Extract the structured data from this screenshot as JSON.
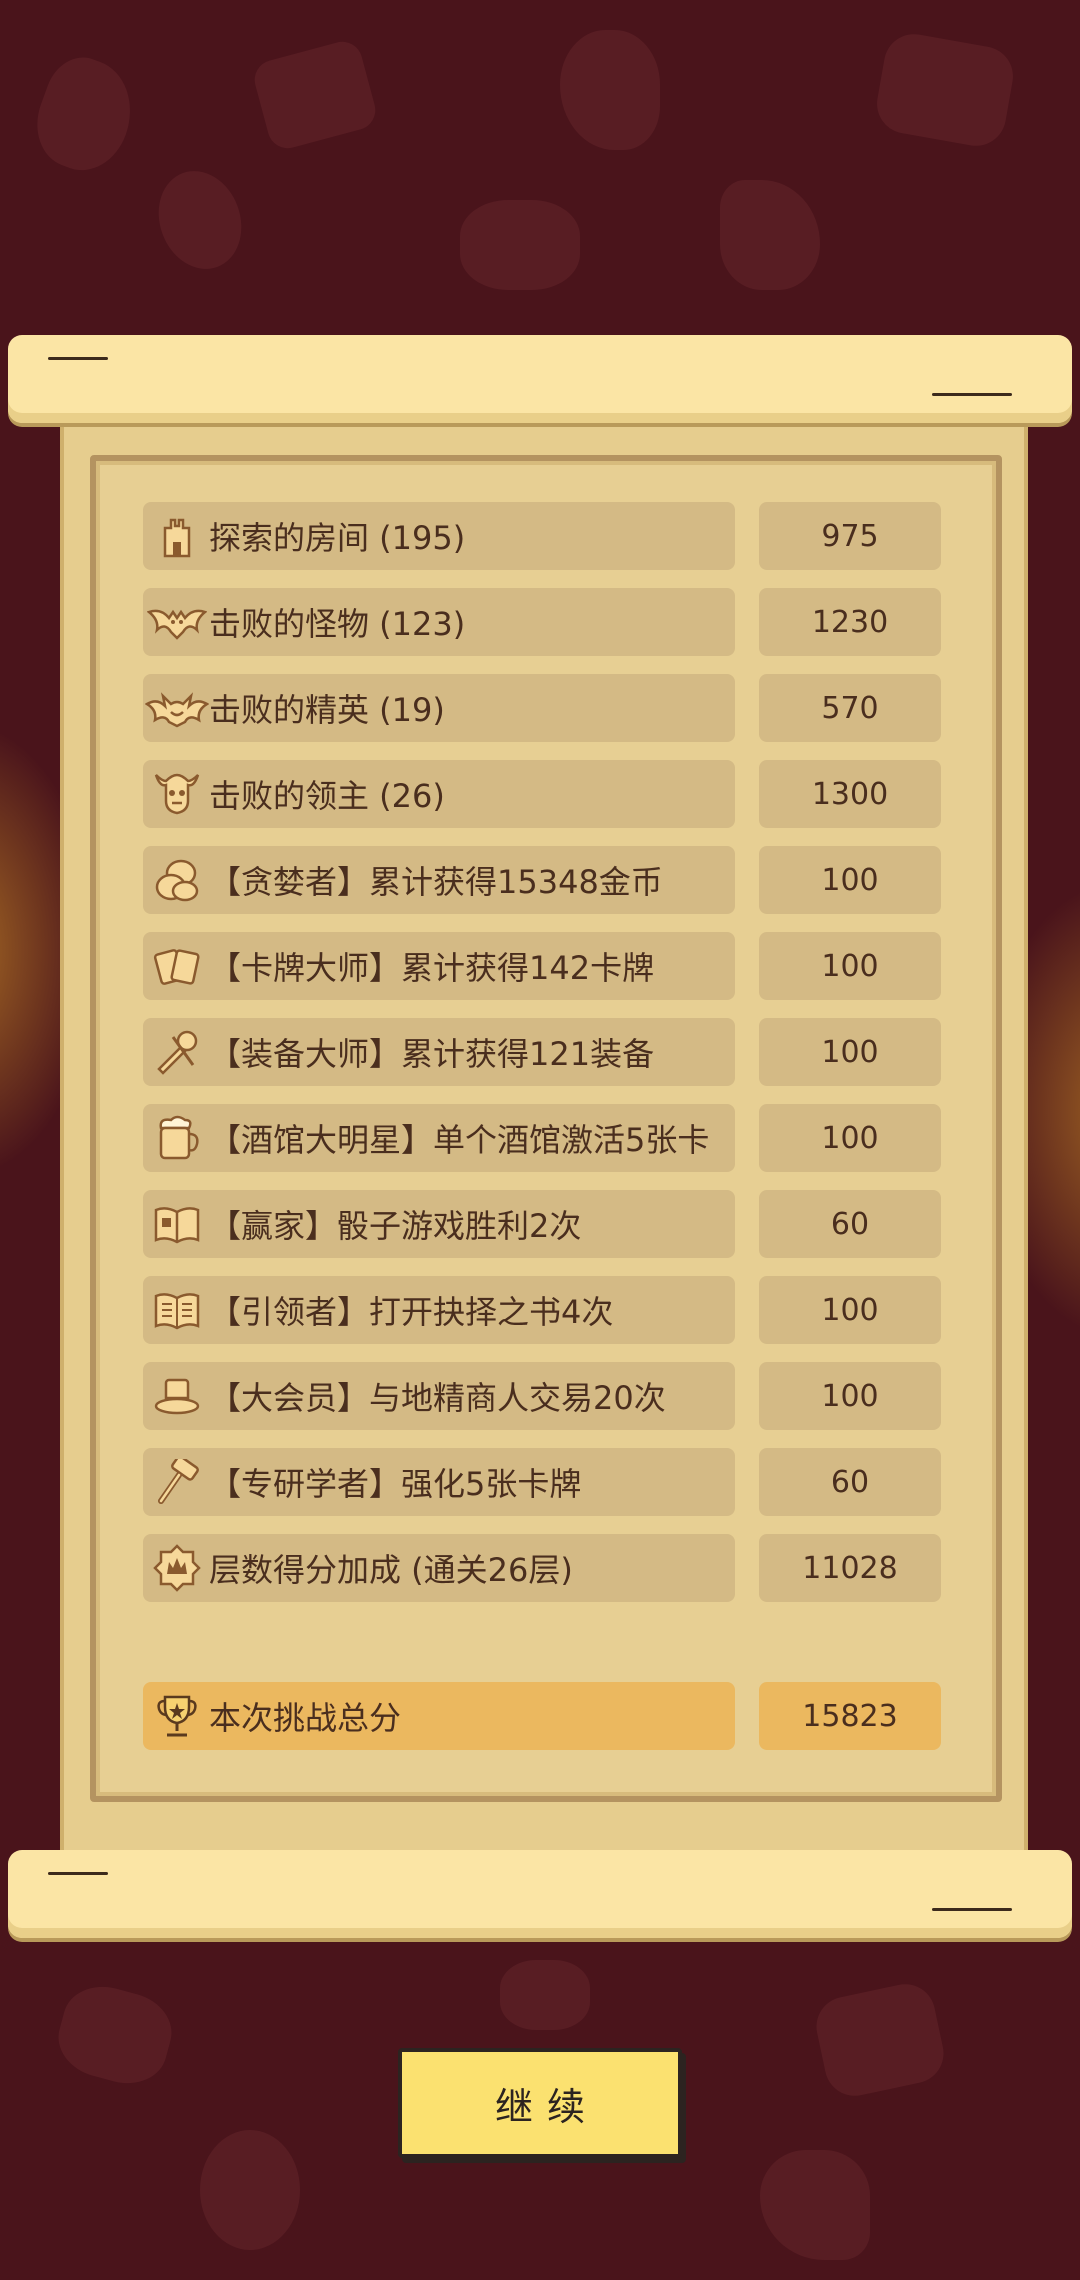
{
  "rows": [
    {
      "label": "探索的房间 (195)",
      "value": "975",
      "icon": "tower-icon"
    },
    {
      "label": "击败的怪物 (123)",
      "value": "1230",
      "icon": "bat-icon"
    },
    {
      "label": "击败的精英 (19)",
      "value": "570",
      "icon": "elite-demon-icon"
    },
    {
      "label": "击败的领主 (26)",
      "value": "1300",
      "icon": "boss-skull-icon"
    },
    {
      "label": "【贪婪者】累计获得15348金币",
      "value": "100",
      "icon": "coins-icon"
    },
    {
      "label": "【卡牌大师】累计获得142卡牌",
      "value": "100",
      "icon": "cards-icon"
    },
    {
      "label": "【装备大师】累计获得121装备",
      "value": "100",
      "icon": "equipment-icon"
    },
    {
      "label": "【酒馆大明星】单个酒馆激活5张卡",
      "value": "100",
      "icon": "beer-mug-icon"
    },
    {
      "label": "【赢家】骰子游戏胜利2次",
      "value": "60",
      "icon": "dice-book-icon"
    },
    {
      "label": "【引领者】打开抉择之书4次",
      "value": "100",
      "icon": "open-book-icon"
    },
    {
      "label": "【大会员】与地精商人交易20次",
      "value": "100",
      "icon": "top-hat-icon"
    },
    {
      "label": "【专研学者】强化5张卡牌",
      "value": "60",
      "icon": "hammer-icon"
    },
    {
      "label": "层数得分加成 (通关26层)",
      "value": "11028",
      "icon": "floor-badge-icon"
    }
  ],
  "total": {
    "label": "本次挑战总分",
    "value": "15823",
    "icon": "trophy-icon"
  },
  "continue_label": "继续"
}
